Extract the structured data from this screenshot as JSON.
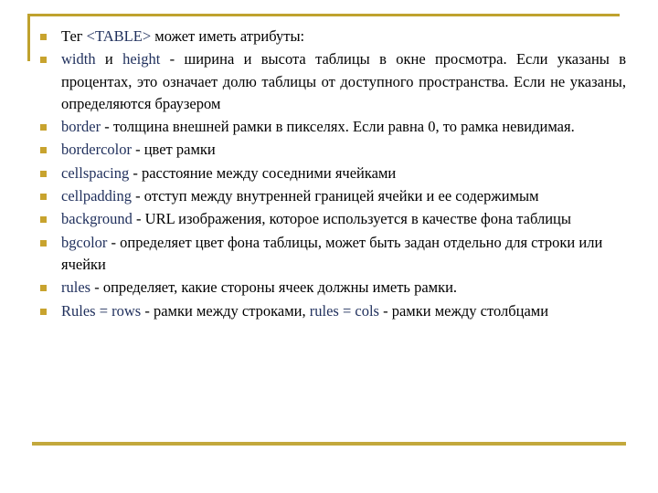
{
  "slide": {
    "accent_color": "#bfa22e",
    "bullet_color": "#c8a32e",
    "keyword_color": "#1f2f5c",
    "text_color": "#000000",
    "background_color": "#ffffff",
    "bullets": [
      {
        "id": "intro",
        "keyword": "",
        "text": "Тег <TABLE> может иметь атрибуты:",
        "lead": "Тег ",
        "code": "<TABLE>",
        "rest": " может иметь атрибуты:",
        "justified": false
      },
      {
        "id": "width-height",
        "keyword": "width",
        "mid": " и ",
        "keyword2": "height",
        "text": " - ширина и высота таблицы в окне просмотра. Если указаны в процентах, это означает долю таблицы от доступного пространства. Если не указаны, определяются браузером",
        "justified": true
      },
      {
        "id": "border",
        "keyword": "border",
        "text": " - толщина внешней рамки в пикселях. Если равна 0, то рамка невидимая.",
        "justified": true
      },
      {
        "id": "bordercolor",
        "keyword": "bordercolor",
        "text": " - цвет рамки",
        "justified": false
      },
      {
        "id": "cellspacing",
        "keyword": "cellspacing",
        "text": " - расстояние между соседними ячейками",
        "justified": false
      },
      {
        "id": "cellpadding",
        "keyword": "cellpadding",
        "text": " - отступ между внутренней границей ячейки и ее содержимым",
        "justified": false
      },
      {
        "id": "background",
        "keyword": "background",
        "text": " - URL изображения, которое используется в качестве фона таблицы",
        "justified": false
      },
      {
        "id": "bgcolor",
        "keyword": "bgcolor",
        "text": " - определяет цвет фона таблицы, может быть задан отдельно для строки или ячейки",
        "justified": false
      },
      {
        "id": "rules",
        "keyword": "rules",
        "text": " - определяет, какие стороны ячеек должны иметь рамки.",
        "justified": false
      },
      {
        "id": "rules-rows-cols",
        "keyword": "Rules = rows",
        "text": " - рамки между строками, ",
        "keyword2": "rules = cols",
        "text2": " - рамки между столбцами",
        "justified": false
      }
    ]
  }
}
